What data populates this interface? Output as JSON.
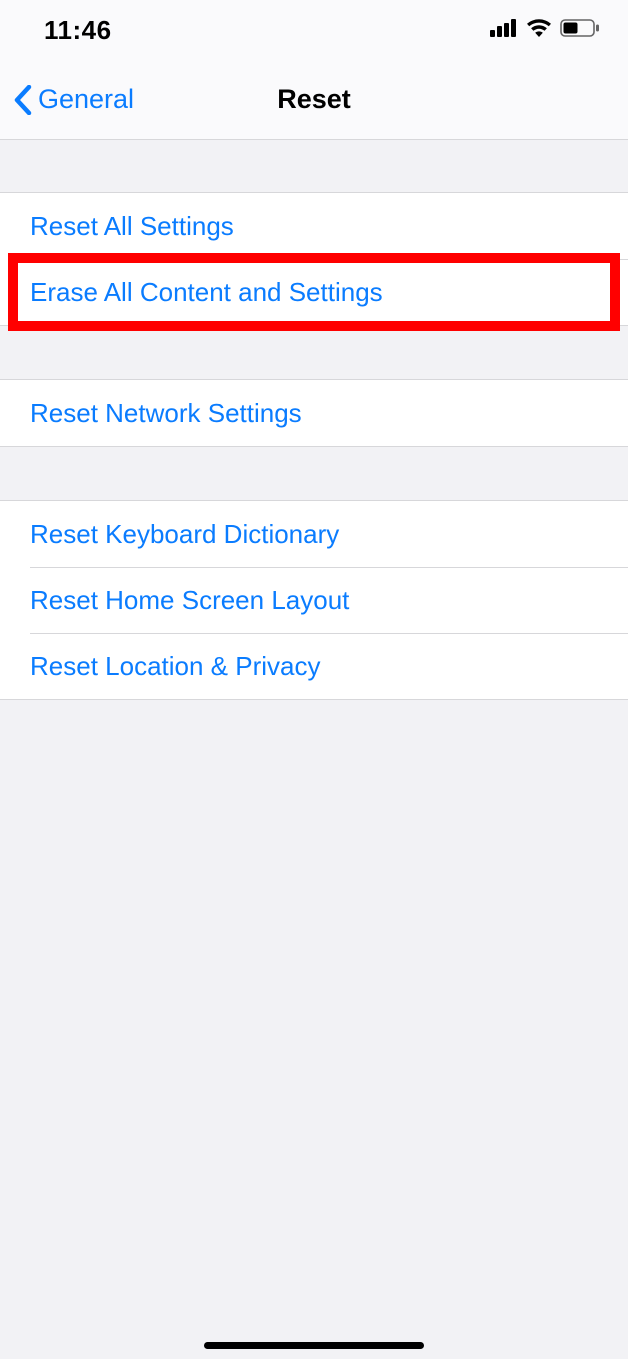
{
  "status": {
    "time": "11:46"
  },
  "nav": {
    "back_label": "General",
    "title": "Reset"
  },
  "groups": [
    {
      "rows": [
        {
          "key": "reset-all-settings",
          "label": "Reset All Settings",
          "highlighted": false
        },
        {
          "key": "erase-all-content-and-settings",
          "label": "Erase All Content and Settings",
          "highlighted": true
        }
      ]
    },
    {
      "rows": [
        {
          "key": "reset-network-settings",
          "label": "Reset Network Settings",
          "highlighted": false
        }
      ]
    },
    {
      "rows": [
        {
          "key": "reset-keyboard-dictionary",
          "label": "Reset Keyboard Dictionary",
          "highlighted": false
        },
        {
          "key": "reset-home-screen-layout",
          "label": "Reset Home Screen Layout",
          "highlighted": false
        },
        {
          "key": "reset-location-privacy",
          "label": "Reset Location & Privacy",
          "highlighted": false
        }
      ]
    }
  ]
}
